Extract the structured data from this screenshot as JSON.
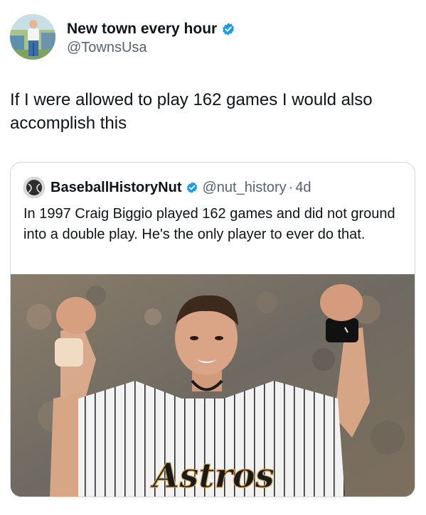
{
  "author": {
    "display_name": "New town every hour",
    "handle": "@TownsUsa",
    "verified_icon": "verified-badge-icon",
    "avatar_icon": "man-figure-icon"
  },
  "tweet": {
    "text": "If I were allowed to play 162 games I would also accomplish this"
  },
  "quoted": {
    "display_name": "BaseballHistoryNut",
    "handle": "@nut_history",
    "separator": "·",
    "time": "4d",
    "text": "In 1997 Craig Biggio played 162 games and did not ground into a double play. He's the only player to ever do that.",
    "image_jersey_text": "Astros"
  },
  "colors": {
    "verified_blue": "#1d9bf0",
    "text_primary": "#0f1419",
    "text_secondary": "#536471",
    "border": "#cfd9de"
  }
}
